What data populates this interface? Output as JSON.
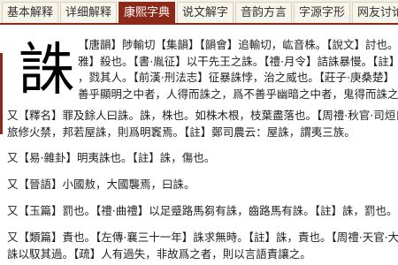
{
  "tabs": [
    {
      "label": "基本解释",
      "active": false
    },
    {
      "label": "详细解释",
      "active": false
    },
    {
      "label": "康熙字典",
      "active": true
    },
    {
      "label": "说文解字",
      "active": false
    },
    {
      "label": "音韵方言",
      "active": false
    },
    {
      "label": "字源字形",
      "active": false
    },
    {
      "label": "网友讨论",
      "active": false
    }
  ],
  "entry": {
    "character": "誅",
    "lines": [
      "【唐韻】陟輸切【集韻】【韻會】追輸切，𡵓音株。【說文】討也。",
      "雅】殺也。【書·胤征】以干先王之誅。【禮·月令】詰誅暴慢。【註】",
      "，戮其人。【前漢·刑法志】征暴誅悖，治之威也。【莊子·庚桑楚】",
      "善乎顯明之中者，人得而誅之，爲不善乎幽暗之中者，鬼得而誅之。"
    ]
  },
  "paragraphs": [
    {
      "lines": [
        "又【釋名】罪及餘人曰誅。誅，株也。如株木根，枝葉盡落也。【周禮·秋官·司烜氏",
        "旅修火禁，邦若屋誅，則爲明竁焉。【註】鄭司農云：屋誅，謂夷三族。"
      ]
    },
    {
      "lines": [
        "又【易·雜卦】明夷誅也。【註】誅，傷也。"
      ]
    },
    {
      "lines": [
        "又【晉語】小國敖，大國襲焉，曰誅。"
      ]
    },
    {
      "lines": [
        "又【玉篇】罰也。【禮·曲禮】以足蹙路馬芻有誅，齒路馬有誅。【註】誅，罰也。"
      ]
    },
    {
      "lines": [
        "又【類篇】責也。【左傳·襄三十一年】誅求無時。【註】誅，責也。【周禮·天官·大",
        "誅以馭其過。【疏】人有過失，非故爲之者，則以言語責讓之。"
      ]
    }
  ]
}
